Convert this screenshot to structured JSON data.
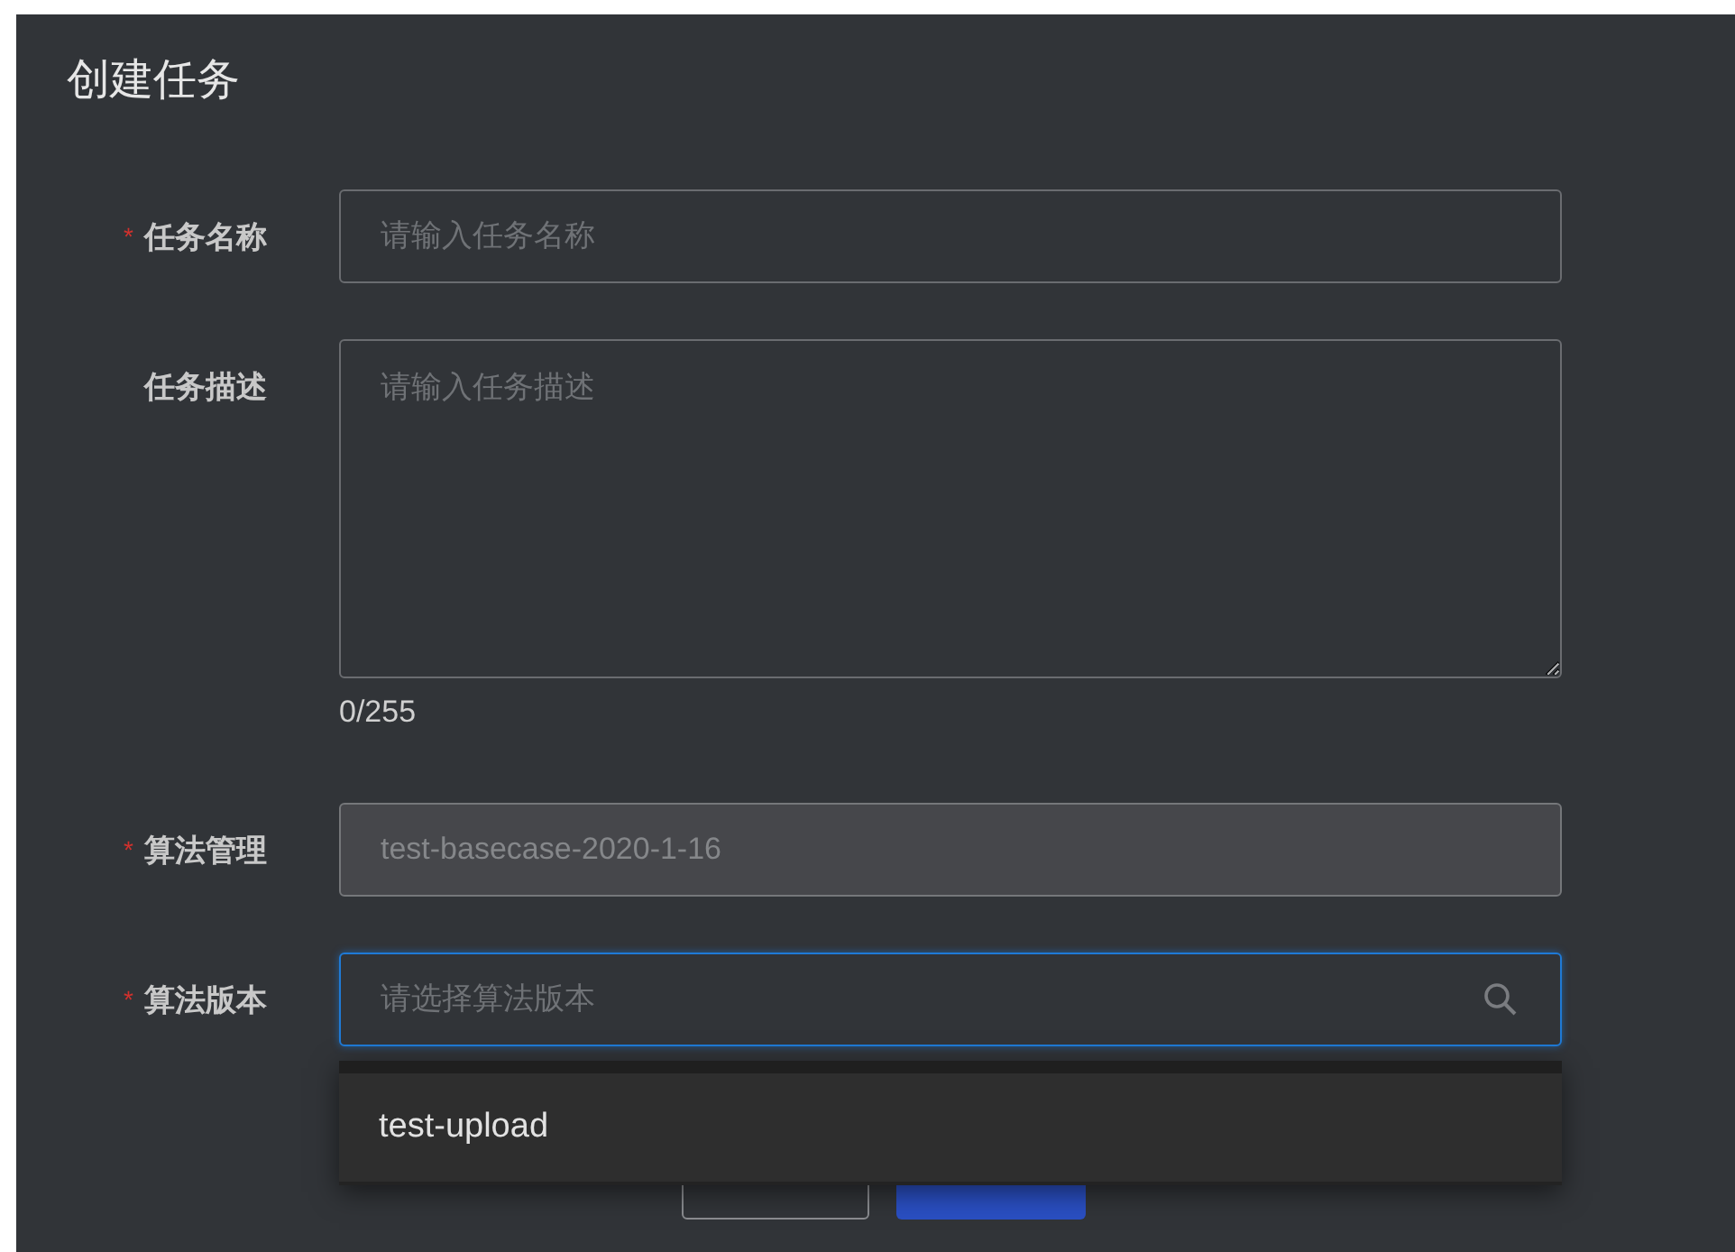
{
  "title": "创建任务",
  "fields": [
    {
      "kind": "input",
      "label": "任务名称",
      "required_mark": "*",
      "placeholder": "请输入任务名称",
      "disabled": false,
      "focused": false
    },
    {
      "kind": "textarea",
      "label": "任务描述",
      "placeholder": "请输入任务描述",
      "counter": "0/255",
      "disabled": false,
      "focused": false
    },
    {
      "kind": "input",
      "label": "算法管理",
      "required_mark": "*",
      "value": "test-basecase-2020-1-16",
      "disabled": true,
      "focused": false
    },
    {
      "kind": "select",
      "label": "算法版本",
      "required_mark": "*",
      "placeholder": "请选择算法版本",
      "disabled": false,
      "focused": true,
      "expanded": true,
      "options": [
        {
          "label": "test-upload"
        }
      ]
    }
  ],
  "buttons": [
    {
      "kind": "default"
    },
    {
      "kind": "primary"
    }
  ]
}
